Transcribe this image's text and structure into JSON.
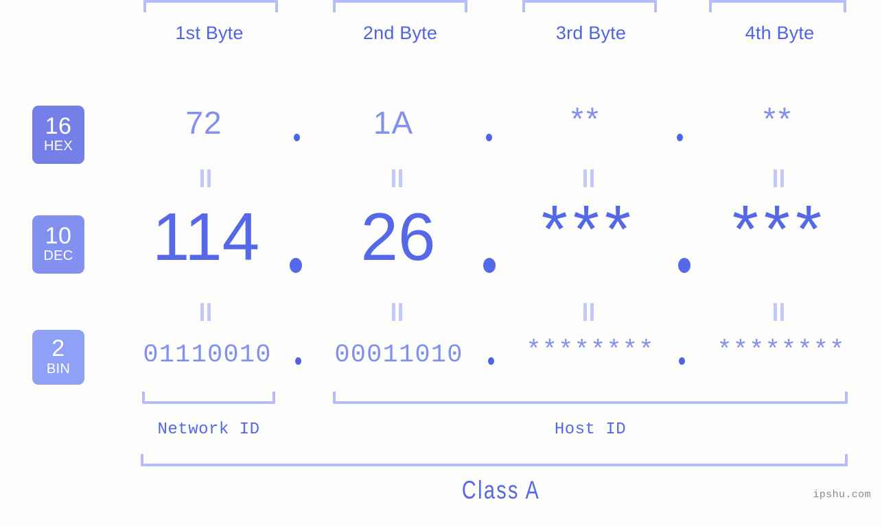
{
  "watermark": "ipshu.com",
  "background_color": "#fdfefb",
  "accent_color": "#5568e8",
  "accent_light_color": "#8190ee",
  "bracket_color": "#b4bdf9",
  "byte_headers": [
    {
      "label": "1st Byte"
    },
    {
      "label": "2nd Byte"
    },
    {
      "label": "3rd Byte"
    },
    {
      "label": "4th Byte"
    }
  ],
  "bases": [
    {
      "number": "16",
      "abbr": "HEX",
      "color": "#7480e8"
    },
    {
      "number": "10",
      "abbr": "DEC",
      "color": "#8290f0"
    },
    {
      "number": "2",
      "abbr": "BIN",
      "color": "#8ea1f6"
    }
  ],
  "rows": {
    "hex": {
      "base_number": "16",
      "base_abbr": "HEX",
      "values": [
        "72",
        "1A",
        "**",
        "**"
      ],
      "separator": "."
    },
    "dec": {
      "base_number": "10",
      "base_abbr": "DEC",
      "values": [
        "114",
        "26",
        "***",
        "***"
      ],
      "separator": "."
    },
    "bin": {
      "base_number": "2",
      "base_abbr": "BIN",
      "values": [
        "01110010",
        "00011010",
        "********",
        "********"
      ],
      "separator": "."
    }
  },
  "equals_marks": {
    "hex_to_dec": [
      "||",
      "||",
      "||",
      "||"
    ],
    "dec_to_bin": [
      "||",
      "||",
      "||",
      "||"
    ]
  },
  "id_sections": [
    {
      "label": "Network ID"
    },
    {
      "label": "Host ID"
    }
  ],
  "class_label": "Class A"
}
